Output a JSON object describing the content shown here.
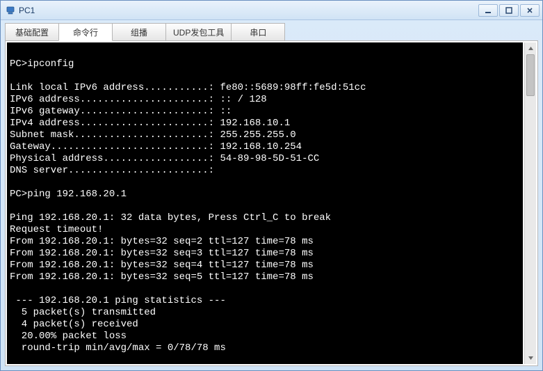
{
  "window": {
    "title": "PC1"
  },
  "tabs": [
    {
      "label": "基础配置"
    },
    {
      "label": "命令行"
    },
    {
      "label": "组播"
    },
    {
      "label": "UDP发包工具"
    },
    {
      "label": "串口"
    }
  ],
  "terminal_text": "\nPC>ipconfig\n\nLink local IPv6 address...........: fe80::5689:98ff:fe5d:51cc\nIPv6 address......................: :: / 128\nIPv6 gateway......................: ::\nIPv4 address......................: 192.168.10.1\nSubnet mask.......................: 255.255.255.0\nGateway...........................: 192.168.10.254\nPhysical address..................: 54-89-98-5D-51-CC\nDNS server........................:\n\nPC>ping 192.168.20.1\n\nPing 192.168.20.1: 32 data bytes, Press Ctrl_C to break\nRequest timeout!\nFrom 192.168.20.1: bytes=32 seq=2 ttl=127 time=78 ms\nFrom 192.168.20.1: bytes=32 seq=3 ttl=127 time=78 ms\nFrom 192.168.20.1: bytes=32 seq=4 ttl=127 time=78 ms\nFrom 192.168.20.1: bytes=32 seq=5 ttl=127 time=78 ms\n\n --- 192.168.20.1 ping statistics ---\n  5 packet(s) transmitted\n  4 packet(s) received\n  20.00% packet loss\n  round-trip min/avg/max = 0/78/78 ms"
}
